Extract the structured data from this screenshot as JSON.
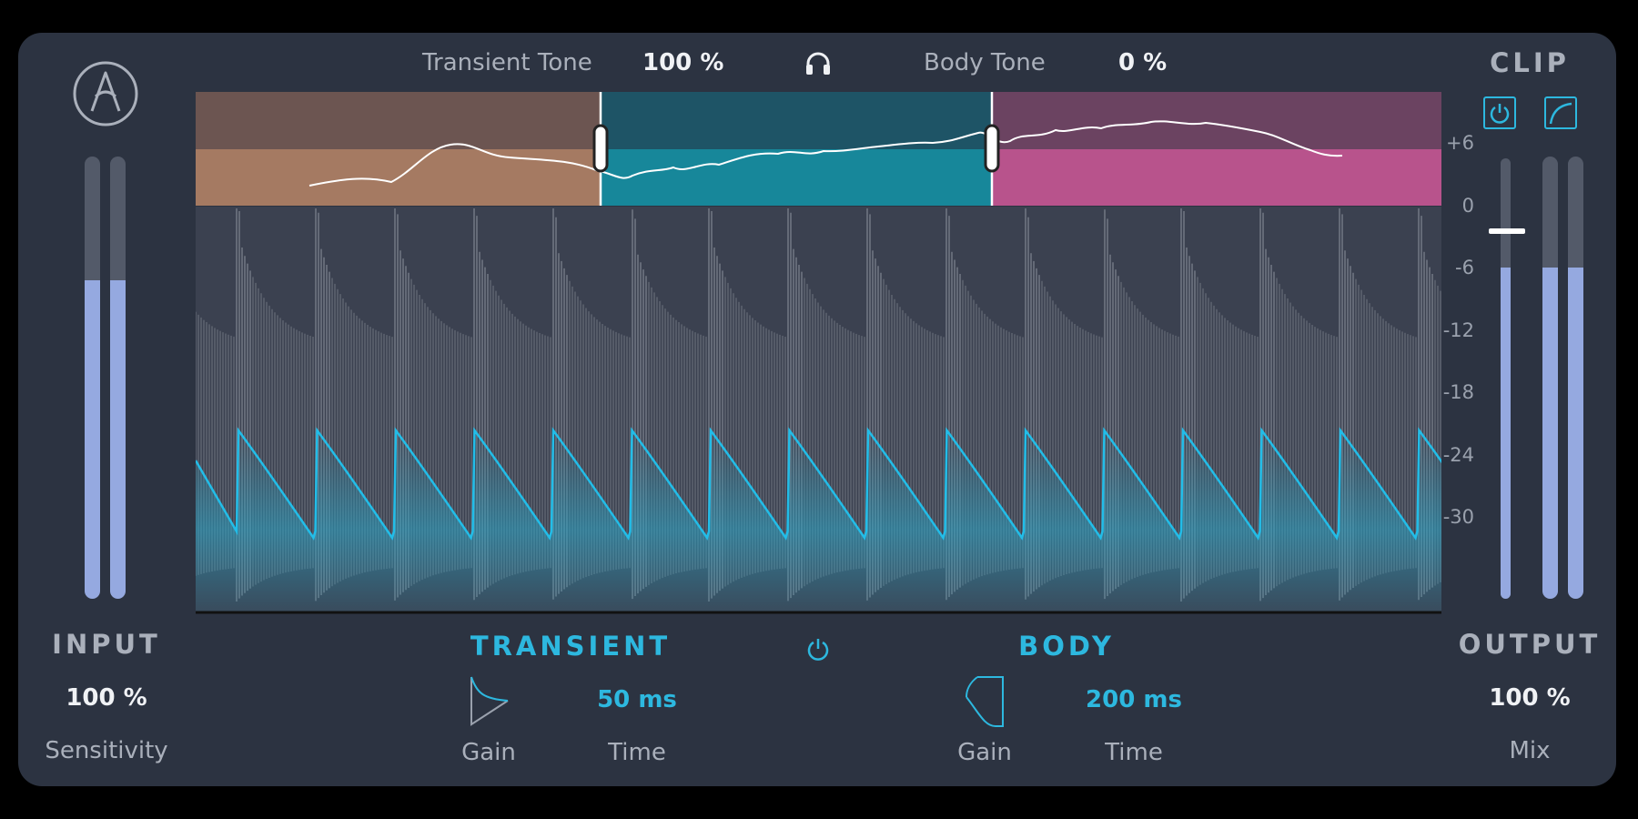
{
  "logo": {
    "icon": "arturia-logo-icon"
  },
  "header": {
    "transient_tone_label": "Transient Tone",
    "transient_tone_value": "100 %",
    "solo_icon": "headphones-icon",
    "body_tone_label": "Body Tone",
    "body_tone_value": "0 %",
    "clip_label": "CLIP"
  },
  "clip": {
    "power_icon": "power-icon",
    "curve_icon": "soft-clip-curve-icon"
  },
  "input": {
    "heading": "INPUT",
    "value": "100 %",
    "label": "Sensitivity",
    "level": 0.72
  },
  "output": {
    "heading": "OUTPUT",
    "value": "100 %",
    "label": "Mix",
    "level": 0.75
  },
  "scale": [
    "+6",
    "0",
    "-6",
    "-12",
    "-18",
    "-24",
    "-30"
  ],
  "transient": {
    "heading": "TRANSIENT",
    "gain_label": "Gain",
    "time_value": "50 ms",
    "time_label": "Time"
  },
  "body": {
    "heading": "BODY",
    "gain_label": "Gain",
    "time_value": "200 ms",
    "time_label": "Time"
  },
  "section_power_icon": "power-icon",
  "colors": {
    "accent": "#2db8df",
    "transient_band": "#a57a62",
    "mid_band": "#17879a",
    "body_band": "#b8538c",
    "meter": "#95a9e0"
  }
}
